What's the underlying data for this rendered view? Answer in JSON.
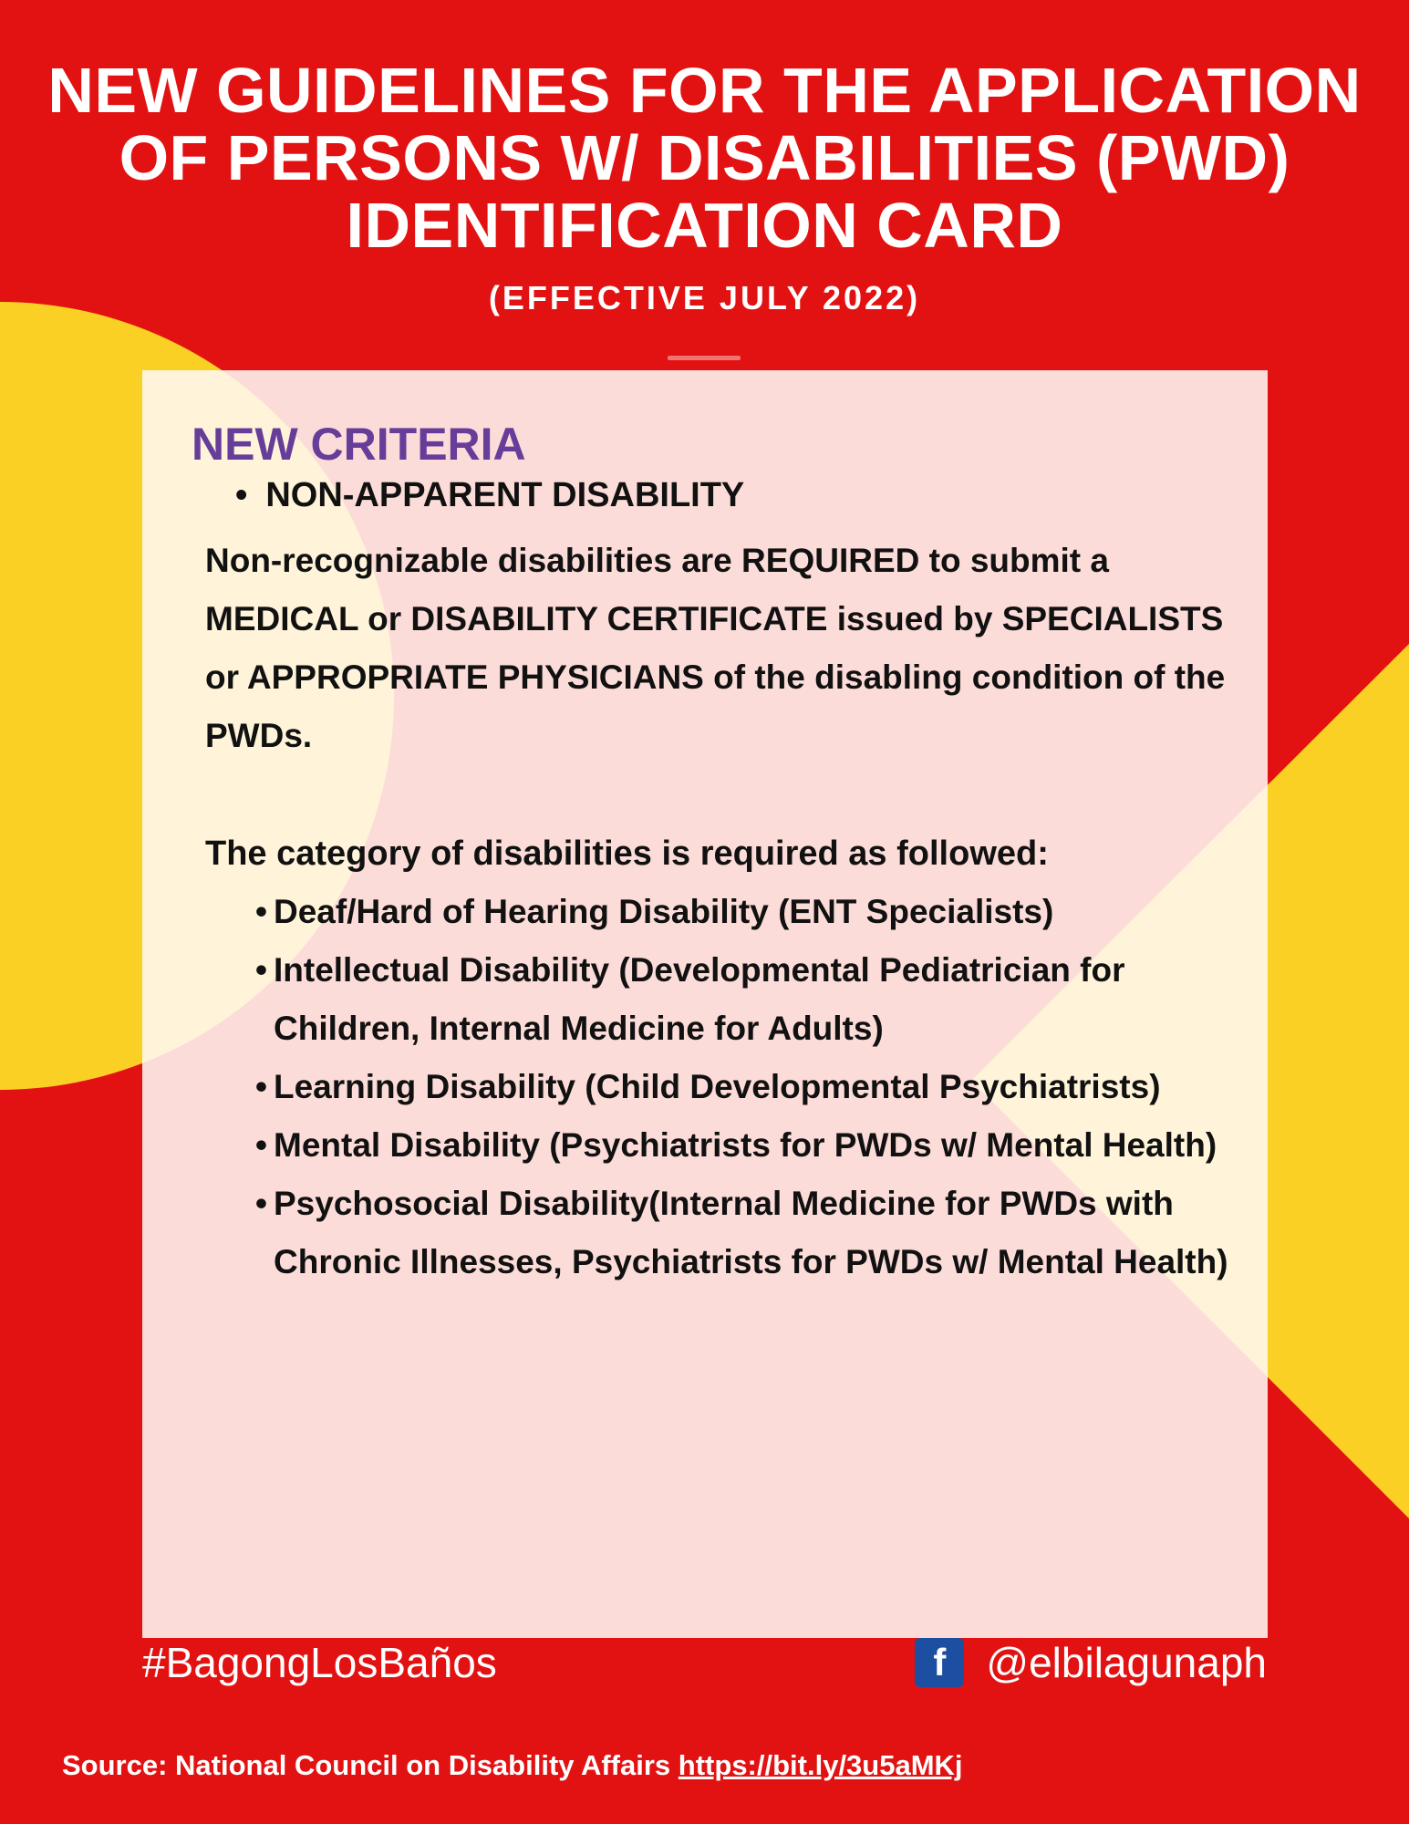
{
  "colors": {
    "background": "#e31212",
    "accent_yellow": "#fad025",
    "card": "#fdf0ea",
    "heading_purple": "#673d9a",
    "facebook_blue": "#1c4fa1"
  },
  "header": {
    "title": "NEW GUIDELINES FOR THE APPLICATION OF PERSONS W/ DISABILITIES (PWD) IDENTIFICATION CARD",
    "subtitle": "(EFFECTIVE JULY 2022)"
  },
  "card": {
    "heading": "NEW CRITERIA",
    "top_bullet": "NON-APPARENT DISABILITY",
    "intro": "Non-recognizable disabilities are REQUIRED to submit a MEDICAL or DISABILITY CERTIFICATE issued by SPECIALISTS or APPROPRIATE PHYSICIANS of the disabling condition of the PWDs.",
    "category_intro": "The category of disabilities is required as followed:",
    "categories": [
      "Deaf/Hard of Hearing Disability (ENT Specialists)",
      "Intellectual Disability (Developmental Pediatrician for Children, Internal Medicine for Adults)",
      "Learning Disability (Child Developmental Psychiatrists)",
      "Mental Disability (Psychiatrists for PWDs w/ Mental Health)",
      "Psychosocial Disability(Internal Medicine for PWDs with Chronic Illnesses, Psychiatrists for PWDs w/ Mental Health)"
    ]
  },
  "footer": {
    "hashtag": "#BagongLosBaños",
    "social_icon": "facebook-icon",
    "social_handle": "@elbilagunaph",
    "source_label": "Source:  National Council on Disability Affairs",
    "source_link": "https://bit.ly/3u5aMKj"
  }
}
